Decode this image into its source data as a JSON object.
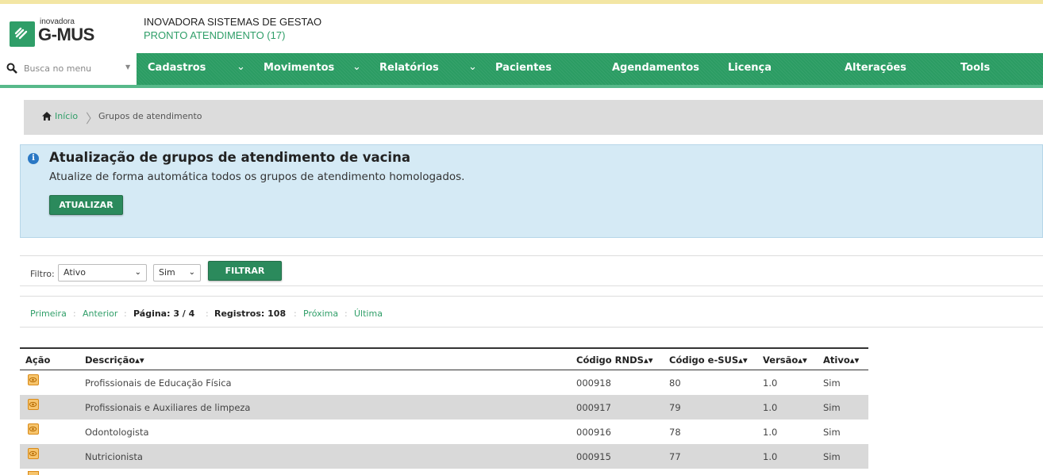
{
  "header": {
    "logo_small": "inovadora",
    "logo_big": "G-MUS",
    "company": "INOVADORA SISTEMAS DE GESTAO",
    "module": "PRONTO ATENDIMENTO (17)"
  },
  "menu": {
    "search_placeholder": "Busca no menu",
    "items": [
      {
        "label": "Cadastros"
      },
      {
        "label": "Movimentos"
      },
      {
        "label": "Relatórios"
      },
      {
        "label": "Pacientes"
      },
      {
        "label": "Agendamentos"
      },
      {
        "label": "Licença"
      },
      {
        "label": "Alterações"
      },
      {
        "label": "Tools"
      }
    ],
    "chevron": "⌄"
  },
  "breadcrumb": {
    "home": "Início",
    "separator": "〉",
    "current": "Grupos de atendimento"
  },
  "info": {
    "icon": "i",
    "title": "Atualização de grupos de atendimento de vacina",
    "text": "Atualize de forma automática todos os grupos de atendimento homologados.",
    "button": "ATUALIZAR"
  },
  "filter": {
    "label": "Filtro:",
    "field_value": "Ativo",
    "bool_value": "Sim",
    "arrow": "⌄",
    "button": "FILTRAR"
  },
  "pager": {
    "first": "Primeira",
    "prev": "Anterior",
    "page_label": "Página: 3 / 4",
    "records_label": "Registros: 108",
    "next": "Próxima",
    "last": "Última",
    "sep": ":"
  },
  "table": {
    "headers": {
      "acao": "Ação",
      "descricao": "Descrição▴▾",
      "rnds": "Código RNDS▴▾",
      "esus": "Código e-SUS▴▾",
      "versao": "Versão▴▾",
      "ativo": "Ativo▴▾"
    },
    "rows": [
      {
        "descricao": "Profissionais de Educação Física",
        "rnds": "000918",
        "esus": "80",
        "versao": "1.0",
        "ativo": "Sim"
      },
      {
        "descricao": "Profissionais e Auxiliares de limpeza",
        "rnds": "000917",
        "esus": "79",
        "versao": "1.0",
        "ativo": "Sim"
      },
      {
        "descricao": "Odontologista",
        "rnds": "000916",
        "esus": "78",
        "versao": "1.0",
        "ativo": "Sim"
      },
      {
        "descricao": "Nutricionista",
        "rnds": "000915",
        "esus": "77",
        "versao": "1.0",
        "ativo": "Sim"
      }
    ]
  },
  "colors": {
    "brand_green": "#2b9c63",
    "link_green": "#2f9e68",
    "info_bg": "#d5eaf5",
    "row_alt": "#d9d9d9"
  }
}
